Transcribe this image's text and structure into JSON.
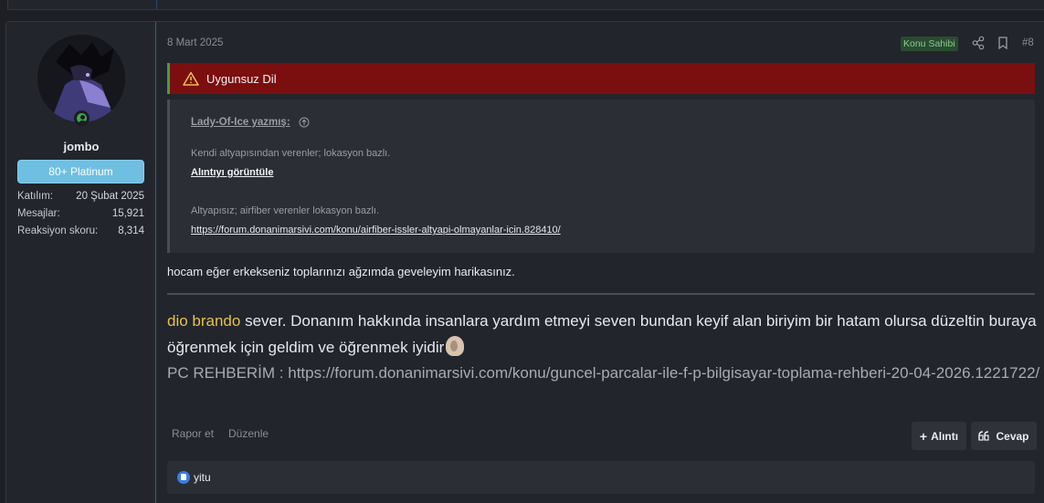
{
  "post": {
    "date": "8 Mart 2025",
    "op_badge": "Konu Sahibi",
    "post_number": "#8"
  },
  "user": {
    "username": "jombo",
    "rank_badge": "80+ Platinum",
    "stats": [
      {
        "label": "Katılım:",
        "value": "20 Şubat 2025"
      },
      {
        "label": "Mesajlar:",
        "value": "15,921"
      },
      {
        "label": "Reaksiyon skoru:",
        "value": "8,314"
      }
    ]
  },
  "warning": {
    "text": "Uygunsuz Dil"
  },
  "quote": {
    "author_line": "Lady-Of-Ice yazmış:",
    "line1": "Kendi altyapısından verenler; lokasyon bazlı.",
    "view_quote": "Alıntıyı görüntüle",
    "line2": "Altyapısız; airfiber verenler lokasyon bazlı.",
    "link": "https://forum.donanimarsivi.com/konu/airfiber-issler-altyapi-olmayanlar-icin.828410/"
  },
  "message": {
    "text": "hocam eğer erkekseniz toplarınızı ağzımda geveleyim harikasınız."
  },
  "signature": {
    "name": "dio brando",
    "text_part1": " sever. Donanım hakkında insanlara yardım etmeyi seven bundan keyif alan biriyim bir hatam olursa düzeltin buraya öğrenmek için geldim ve öğrenmek iyidir",
    "pc_guide": "PC REHBERİM : https://forum.donanimarsivi.com/konu/guncel-parcalar-ile-f-p-bilgisayar-toplama-rehberi-20-04-2026.1221722/"
  },
  "actions": {
    "report": "Rapor et",
    "edit": "Düzenle",
    "quote_btn": "Alıntı",
    "reply_btn": "Cevap"
  },
  "reactions": {
    "users": "yitu"
  }
}
